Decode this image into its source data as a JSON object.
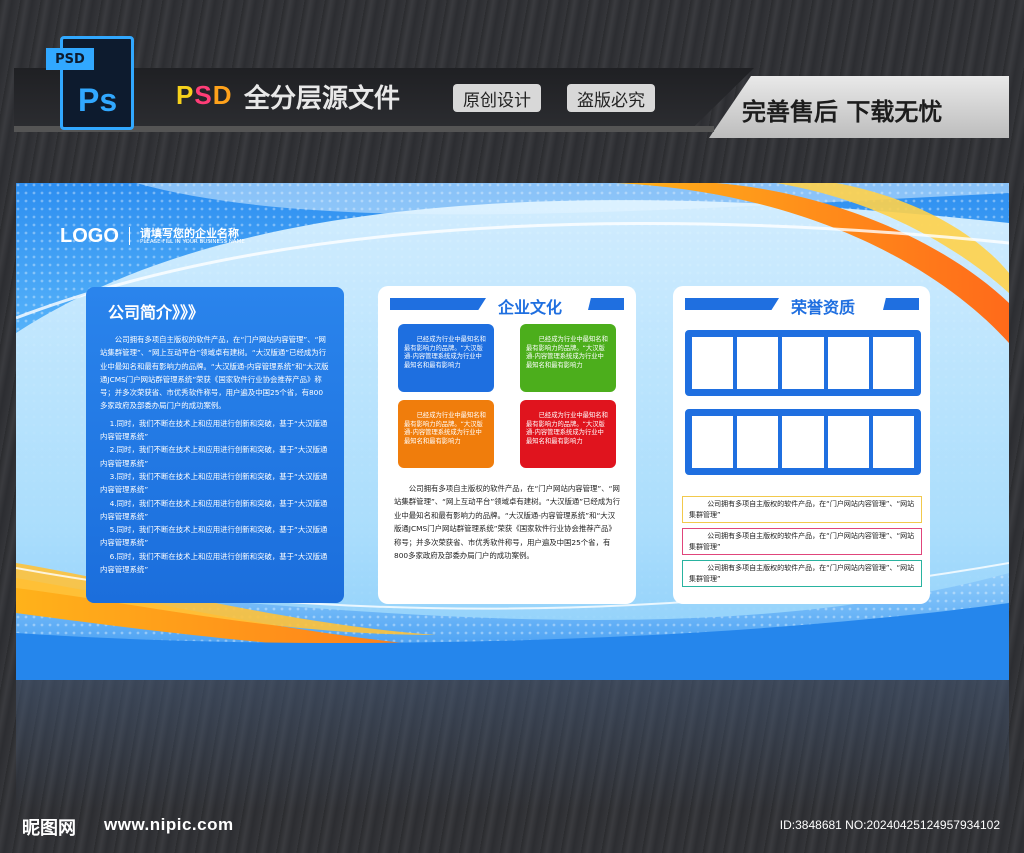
{
  "banner": {
    "file_tag": "PSD",
    "file_icon_letters": "Ps",
    "psd_letters": [
      "P",
      "S",
      "D"
    ],
    "title": "全分层源文件",
    "pill_original": "原创设计",
    "pill_piracy": "盗版必究",
    "slogan": "完善售后  下载无忧"
  },
  "board": {
    "logo": "LOGO",
    "company_cn": "请填写您的企业名称",
    "company_en": "PLEASE FILL IN YOUR BUSINESS NAME",
    "intro": {
      "title": "公司简介》》》",
      "paragraph": "公司拥有多项自主版权的软件产品，在“门户网站内容管理”、“网站集群管理”、“网上互动平台”领域卓有建树。“大汉版通”已经成为行业中最知名和最有影响力的品牌。“大汉版通-内容管理系统”和“大汉版通JCMS门户网站群管理系统”荣获《国家软件行业协会推荐产品》称号；并多次荣获省、市优秀软件称号，用户遍及中国25个省，有800多家政府及部委办局门户的成功案例。",
      "items": [
        "1.同时，我们不断在技术上和应用进行创新和突破，基于“大汉版通内容管理系统”",
        "2.同时，我们不断在技术上和应用进行创新和突破，基于“大汉版通内容管理系统”",
        "3.同时，我们不断在技术上和应用进行创新和突破，基于“大汉版通内容管理系统”",
        "4.同时，我们不断在技术上和应用进行创新和突破，基于“大汉版通内容管理系统”",
        "5.同时，我们不断在技术上和应用进行创新和突破，基于“大汉版通内容管理系统”",
        "6.同时，我们不断在技术上和应用进行创新和突破，基于“大汉版通内容管理系统”"
      ]
    },
    "culture": {
      "title": "企业文化",
      "box_text": "已经成为行业中最知名和最有影响力的品牌。“大汉版通-内容管理系统成为行业中最知名和最有影响力",
      "colors": [
        "#1e6fe0",
        "#4cae1c",
        "#f07d0c",
        "#e0141e"
      ],
      "paragraph": "公司拥有多项自主版权的软件产品，在“门户网站内容管理”、“网站集群管理”、“网上互动平台”领域卓有建树。“大汉版通”已经成为行业中最知名和最有影响力的品牌。“大汉版通-内容管理系统”和“大汉版通JCMS门户网站群管理系统”荣获《国家软件行业协会推荐产品》称号；并多次荣获省、市优秀软件称号，用户遍及中国25个省，有800多家政府及部委办局门户的成功案例。"
    },
    "honor": {
      "title": "荣誉资质",
      "note_text": "公司拥有多项自主版权的软件产品，在“门户网站内容管理”、“网站集群管理”",
      "note_colors": [
        "#f2c94c",
        "#e0457b",
        "#29b3a0"
      ]
    }
  },
  "watermark": {
    "site_cn": "昵图网",
    "url": "www.nipic.com",
    "id": "ID:3848681 NO:20240425124957934102"
  }
}
